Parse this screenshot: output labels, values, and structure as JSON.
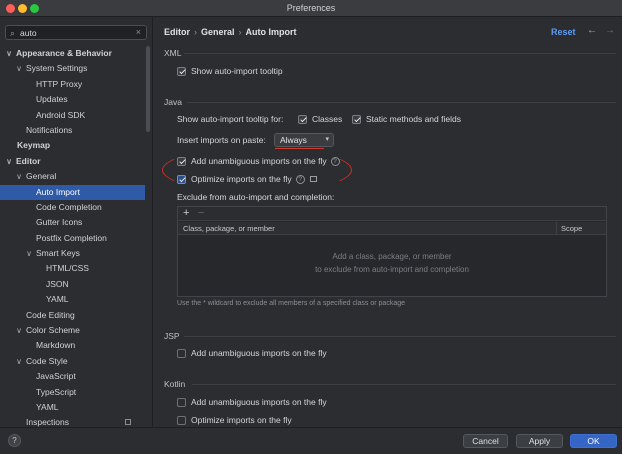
{
  "window": {
    "title": "Preferences"
  },
  "search": {
    "value": "auto",
    "clear": "×",
    "icon": "⌕"
  },
  "tree": [
    {
      "label": "Appearance & Behavior",
      "chev": "∨",
      "bold": true,
      "indent": 0
    },
    {
      "label": "System Settings",
      "chev": "∨",
      "indent": 1
    },
    {
      "label": "HTTP Proxy",
      "indent": 2
    },
    {
      "label": "Updates",
      "indent": 2
    },
    {
      "label": "Android SDK",
      "indent": 2
    },
    {
      "label": "Notifications",
      "indent": 1
    },
    {
      "label": "Keymap",
      "bold": true,
      "indent": 0,
      "noChev": true
    },
    {
      "label": "Editor",
      "chev": "∨",
      "bold": true,
      "indent": 0
    },
    {
      "label": "General",
      "chev": "∨",
      "indent": 1
    },
    {
      "label": "Auto Import",
      "indent": 2,
      "selected": true
    },
    {
      "label": "Code Completion",
      "indent": 2
    },
    {
      "label": "Gutter Icons",
      "indent": 2
    },
    {
      "label": "Postfix Completion",
      "indent": 2
    },
    {
      "label": "Smart Keys",
      "chev": "∨",
      "indent": 2
    },
    {
      "label": "HTML/CSS",
      "indent": 3
    },
    {
      "label": "JSON",
      "indent": 3
    },
    {
      "label": "YAML",
      "indent": 3
    },
    {
      "label": "Code Editing",
      "indent": 1
    },
    {
      "label": "Color Scheme",
      "chev": "∨",
      "indent": 1
    },
    {
      "label": "Markdown",
      "indent": 2
    },
    {
      "label": "Code Style",
      "chev": "∨",
      "indent": 1
    },
    {
      "label": "JavaScript",
      "indent": 2
    },
    {
      "label": "TypeScript",
      "indent": 2
    },
    {
      "label": "YAML",
      "indent": 2
    },
    {
      "label": "Inspections",
      "indent": 1,
      "badge": true
    }
  ],
  "header": {
    "crumbs": [
      "Editor",
      "General",
      "Auto Import"
    ],
    "separator": "›",
    "reset": "Reset",
    "back": "←",
    "forward": "→"
  },
  "xml": {
    "title": "XML",
    "show_tooltip": "Show auto-import tooltip",
    "show_tooltip_checked": true
  },
  "java": {
    "title": "Java",
    "tooltip_for": "Show auto-import tooltip for:",
    "classes": "Classes",
    "static": "Static methods and fields",
    "paste_label": "Insert imports on paste:",
    "paste_value": "Always",
    "paste_arrow": "▾",
    "unambiguous": "Add unambiguous imports on the fly",
    "optimize": "Optimize imports on the fly",
    "help": "?",
    "exclude_label": "Exclude from auto-import and completion:",
    "table": {
      "add": "+",
      "remove": "−",
      "col1": "Class, package, or member",
      "col2": "Scope",
      "empty_line1": "Add a class, package, or member",
      "empty_line2": "to exclude from auto-import and completion"
    },
    "hint": "Use the * wildcard to exclude all members of a specified class or package"
  },
  "jsp": {
    "title": "JSP",
    "unambiguous": "Add unambiguous imports on the fly"
  },
  "kotlin": {
    "title": "Kotlin",
    "unambiguous": "Add unambiguous imports on the fly",
    "optimize": "Optimize imports on the fly"
  },
  "footer": {
    "help": "?",
    "cancel": "Cancel",
    "apply": "Apply",
    "ok": "OK"
  },
  "colors": {
    "accent": "#3566c6",
    "selection": "#2e5aa8",
    "annotation": "#cf2f25",
    "link": "#5b9bf2"
  }
}
